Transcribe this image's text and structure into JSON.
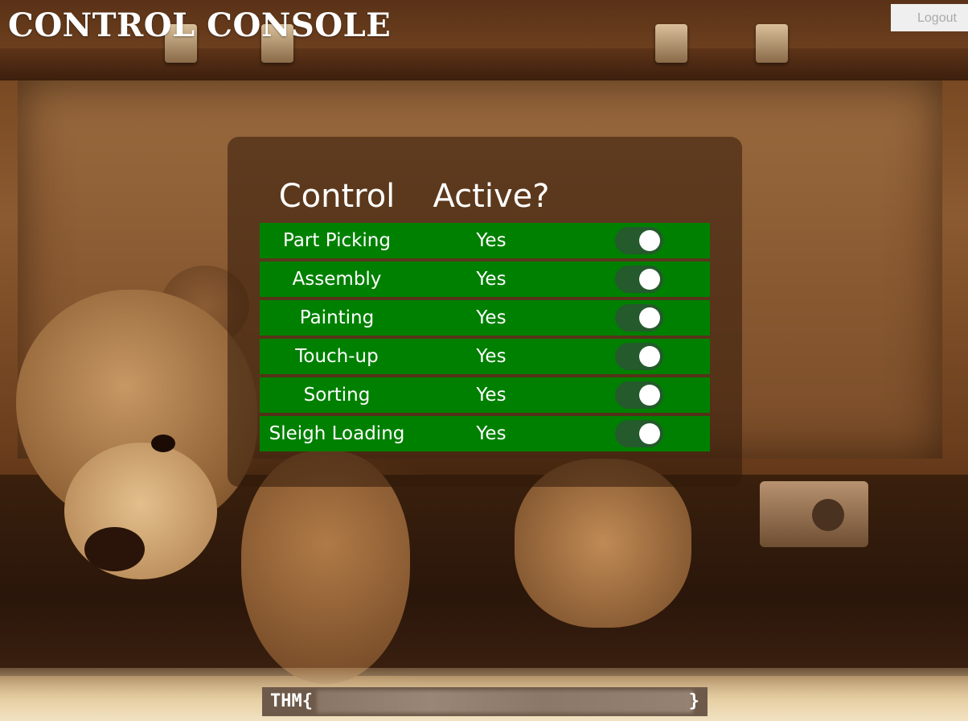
{
  "header": {
    "title": "CONTROL CONSOLE",
    "logout_label": "Logout"
  },
  "table": {
    "columns": [
      "Control",
      "Active?"
    ],
    "rows": [
      {
        "control": "Part Picking",
        "active": "Yes",
        "toggle_on": true
      },
      {
        "control": "Assembly",
        "active": "Yes",
        "toggle_on": true
      },
      {
        "control": "Painting",
        "active": "Yes",
        "toggle_on": true
      },
      {
        "control": "Touch-up",
        "active": "Yes",
        "toggle_on": true
      },
      {
        "control": "Sorting",
        "active": "Yes",
        "toggle_on": true
      },
      {
        "control": "Sleigh Loading",
        "active": "Yes",
        "toggle_on": true
      }
    ]
  },
  "flag": {
    "prefix": "THM{",
    "suffix": "}",
    "value_redacted": true
  },
  "colors": {
    "row_green": "#008000",
    "switch_track": "#245a2c",
    "panel_overlay": "#32190a"
  }
}
